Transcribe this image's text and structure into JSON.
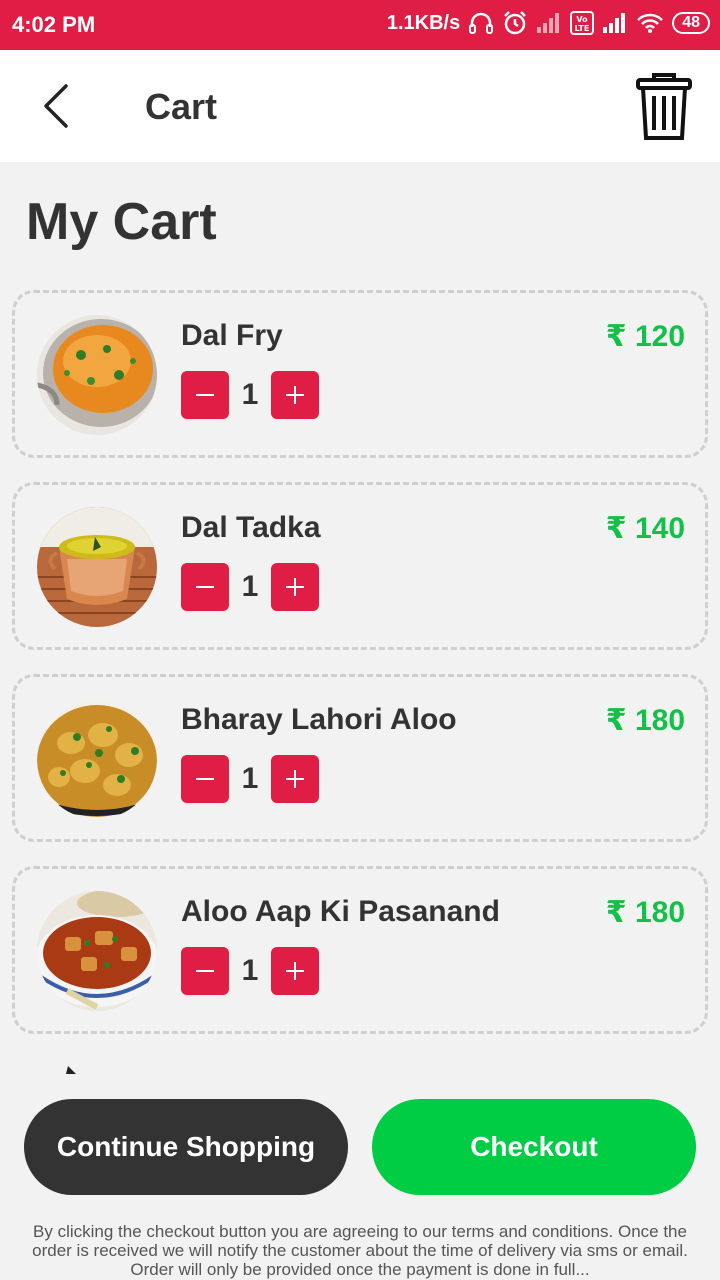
{
  "status_bar": {
    "time": "4:02 PM",
    "speed": "1.1KB/s",
    "battery": "48",
    "icons": [
      "headset-icon",
      "alarm-icon",
      "signal-icon",
      "volte-icon",
      "signal-icon",
      "wifi-icon",
      "battery-icon"
    ]
  },
  "app_bar": {
    "title": "Cart",
    "back_icon": "chevron-left-icon",
    "delete_icon": "trash-icon"
  },
  "page": {
    "title": "My Cart"
  },
  "cart": {
    "items": [
      {
        "name": "Dal Fry",
        "price": "₹ 120",
        "qty": "1"
      },
      {
        "name": "Dal Tadka",
        "price": "₹ 140",
        "qty": "1"
      },
      {
        "name": "Bharay Lahori Aloo",
        "price": "₹ 180",
        "qty": "1"
      },
      {
        "name": "Aloo Aap Ki Pasanand",
        "price": "₹ 180",
        "qty": "1"
      }
    ]
  },
  "actions": {
    "continue_label": "Continue Shopping",
    "checkout_label": "Checkout"
  },
  "terms": "By clicking the checkout button you are agreeing to our terms and conditions. Once the order is received we will notify the customer about the time of delivery via sms or email. Order will only be provided once the payment is done in full...",
  "colors": {
    "accent": "#e01e45",
    "price": "#13c04a",
    "checkout": "#00cc44",
    "continue": "#333333"
  }
}
